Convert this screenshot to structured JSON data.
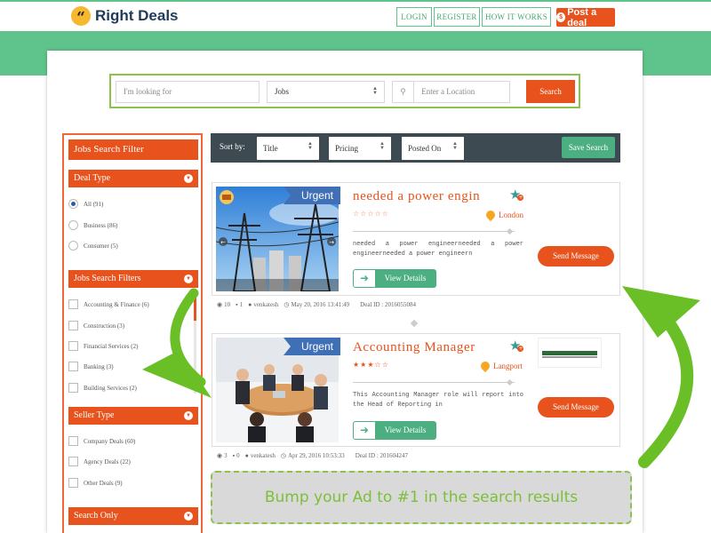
{
  "header": {
    "logo_text": "Right Deals",
    "nav": [
      "LOGIN",
      "REGISTER",
      "HOW IT WORKS"
    ],
    "post_label": "Post a deal"
  },
  "search": {
    "keyword_placeholder": "I'm looking for",
    "category_value": "Jobs",
    "location_placeholder": "Enter a Location",
    "button_label": "Search"
  },
  "sidebar": {
    "title": "Jobs Search Filter",
    "deal_type": {
      "label": "Deal Type",
      "options": [
        "All (91)",
        "Business (86)",
        "Consumer (5)"
      ],
      "selected_index": 0
    },
    "jobs_filters": {
      "label": "Jobs Search Filters",
      "options": [
        "Accounting & Finance (6)",
        "Construction (3)",
        "Financial Services (2)",
        "Banking (3)",
        "Building Services (2)"
      ]
    },
    "seller_type": {
      "label": "Seller Type",
      "options": [
        "Company Deals (60)",
        "Agency Deals (22)",
        "Other Deals (9)"
      ]
    },
    "search_only": {
      "label": "Search Only"
    }
  },
  "sort": {
    "label": "Sort by:",
    "options": [
      "Title",
      "Pricing",
      "Posted On"
    ],
    "save_label": "Save Search"
  },
  "listings": [
    {
      "badge": "Urgent",
      "title": "needed a power engin",
      "stars": "☆☆☆☆☆",
      "location": "London",
      "description": "needed a power engineerneeded a power engineerneeded a power engineern",
      "view_label": "View Details",
      "message_label": "Send Message",
      "photos": "10",
      "videos": "1",
      "user": "venkatesh",
      "date": "May 20, 2016 13:41:49",
      "deal_id": "Deal ID : 2016055084"
    },
    {
      "badge": "Urgent",
      "title": "Accounting Manager",
      "stars": "★★★☆☆",
      "location": "Langport",
      "description": "This Accounting Manager role will report into the Head of Reporting in",
      "view_label": "View Details",
      "message_label": "Send Message",
      "photos": "3",
      "videos": "0",
      "user": "venkatesh",
      "date": "Apr 29, 2016 10:53:33",
      "deal_id": "Deal ID : 201604247"
    }
  ],
  "promo": {
    "text": "Bump your Ad to #1 in the search results"
  },
  "colors": {
    "brand_green": "#5fc48b",
    "accent_orange": "#e8521c",
    "sort_bar": "#3e4a51",
    "promo_green": "#7cbf3a"
  }
}
